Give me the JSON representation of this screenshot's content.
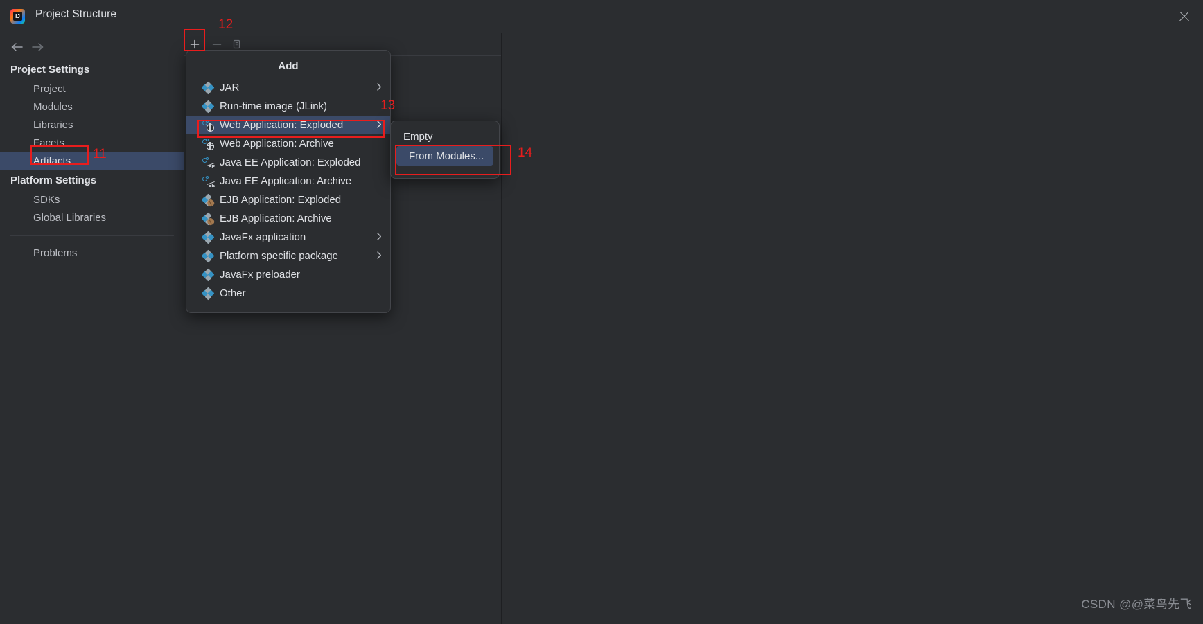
{
  "window": {
    "title": "Project Structure",
    "logo_icon": "intellij-idea-logo",
    "close_icon": "close-icon"
  },
  "nav": {
    "back_icon": "arrow-left-icon",
    "forward_icon": "arrow-right-icon"
  },
  "sidebar": {
    "groups": [
      {
        "title": "Project Settings",
        "items": [
          {
            "label": "Project",
            "selected": false
          },
          {
            "label": "Modules",
            "selected": false
          },
          {
            "label": "Libraries",
            "selected": false
          },
          {
            "label": "Facets",
            "selected": false
          },
          {
            "label": "Artifacts",
            "selected": true
          }
        ]
      },
      {
        "title": "Platform Settings",
        "items": [
          {
            "label": "SDKs",
            "selected": false
          },
          {
            "label": "Global Libraries",
            "selected": false
          }
        ]
      }
    ],
    "footer_items": [
      {
        "label": "Problems",
        "selected": false
      }
    ]
  },
  "toolbar": {
    "add_icon": "plus-icon",
    "remove_icon": "minus-icon",
    "copy_icon": "copy-icon"
  },
  "add_menu": {
    "title": "Add",
    "items": [
      {
        "label": "JAR",
        "icon": "artifact-diamond-icon",
        "submenu": true,
        "highlighted": false
      },
      {
        "label": "Run-time image (JLink)",
        "icon": "artifact-diamond-icon",
        "submenu": false,
        "highlighted": false
      },
      {
        "label": "Web Application: Exploded",
        "icon": "web-artifact-icon",
        "submenu": true,
        "highlighted": true
      },
      {
        "label": "Web Application: Archive",
        "icon": "web-artifact-icon",
        "submenu": false,
        "highlighted": false
      },
      {
        "label": "Java EE Application: Exploded",
        "icon": "javaee-artifact-icon",
        "submenu": false,
        "highlighted": false
      },
      {
        "label": "Java EE Application: Archive",
        "icon": "javaee-artifact-icon",
        "submenu": false,
        "highlighted": false
      },
      {
        "label": "EJB Application: Exploded",
        "icon": "ejb-artifact-icon",
        "submenu": false,
        "highlighted": false
      },
      {
        "label": "EJB Application: Archive",
        "icon": "ejb-artifact-icon",
        "submenu": false,
        "highlighted": false
      },
      {
        "label": "JavaFx application",
        "icon": "artifact-diamond-icon",
        "submenu": true,
        "highlighted": false
      },
      {
        "label": "Platform specific package",
        "icon": "artifact-diamond-icon",
        "submenu": true,
        "highlighted": false
      },
      {
        "label": "JavaFx preloader",
        "icon": "artifact-diamond-icon",
        "submenu": false,
        "highlighted": false
      },
      {
        "label": "Other",
        "icon": "artifact-diamond-icon",
        "submenu": false,
        "highlighted": false
      }
    ]
  },
  "sub_menu": {
    "items": [
      {
        "label": "Empty",
        "highlighted": false
      },
      {
        "label": "From Modules...",
        "highlighted": true
      }
    ]
  },
  "annotations": [
    {
      "number": "11",
      "target": "artifacts-sidebar-item"
    },
    {
      "number": "12",
      "target": "add-artifact-button"
    },
    {
      "number": "13",
      "target": "web-application-exploded-menu-item"
    },
    {
      "number": "14",
      "target": "from-modules-submenu-item"
    }
  ],
  "colors": {
    "background": "#2b2d30",
    "selection": "#3b4a68",
    "annotation": "#e81d1d",
    "text": "#bcbec4",
    "text_bright": "#dfe1e5",
    "icon_blue": "#3592c4"
  },
  "watermark": {
    "text": "CSDN @@菜鸟先飞"
  }
}
